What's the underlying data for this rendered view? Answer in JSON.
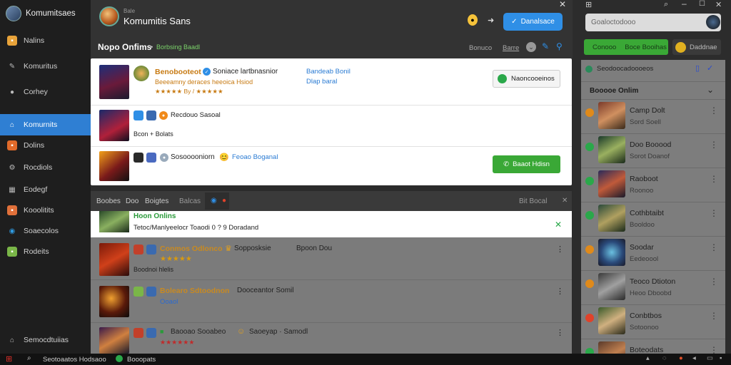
{
  "app": {
    "title": "Komumitsaes"
  },
  "sidebar": {
    "items": [
      {
        "label": "Nalins",
        "icon": "folder-icon",
        "color": "#e8a33a"
      },
      {
        "label": "Komuritus",
        "icon": "pencil-icon",
        "color": "#bdbdbd"
      },
      {
        "label": "Corhey",
        "icon": "circle-icon",
        "color": "#bdbdbd"
      },
      {
        "label": "Komurnits",
        "icon": "home-icon",
        "color": "#ffffff"
      },
      {
        "label": "Dolins",
        "icon": "gamepad-icon",
        "color": "#e06a2a"
      },
      {
        "label": "Rocdiols",
        "icon": "gear-icon",
        "color": "#bdbdbd"
      },
      {
        "label": "Eodegf",
        "icon": "grid-icon",
        "color": "#bdbdbd"
      },
      {
        "label": "Kooolitits",
        "icon": "puzzle-icon",
        "color": "#e0703a"
      },
      {
        "label": "Soaecolos",
        "icon": "globe-icon",
        "color": "#2f9ae0"
      },
      {
        "label": "Rodeits",
        "icon": "apps-icon",
        "color": "#7ab648"
      }
    ],
    "footer_label": "Semocdtuiias"
  },
  "header": {
    "title_small": "Bale",
    "title": "Komumitis Sans",
    "section": "Nopo Onfims",
    "section_sub": "Borbsing Baadl",
    "join_label": "Danalsace",
    "nav_links": [
      "Bonuco",
      "Barre"
    ]
  },
  "cards": [
    {
      "name": "Benobooteot",
      "tag": "Soniace lartbnasnior",
      "stars": "★★★★★ By / ★★★★★",
      "sub": "Beeeamny deraces heeoica Hsiod",
      "badge": "Bandeab Bonil",
      "badge2": "Dlap baral",
      "action": "Naoncooeinos"
    },
    {
      "name": "Recdouo Sasoal",
      "sub": "Bcon + Bolats"
    },
    {
      "name": "Sosooooniorn",
      "tag": "Feoao Boganal",
      "action": "Baaot Hdisn"
    }
  ],
  "strip": {
    "tabs": [
      "Boobes",
      "Doo",
      "Boigtes",
      "Balcas"
    ],
    "right": "Bit Bocal"
  },
  "notice": {
    "title": "Hoon Onlins",
    "text": "Tetoc/Manlyeelocr Toaodi 0 ? 9 Doradand"
  },
  "dim_rows": [
    {
      "name": "Conmos Odlonco",
      "tag": "Sopposksie",
      "tag2": "Bpoon Dou",
      "stars": "★★★★★",
      "sub": "Boodnoi hlelis"
    },
    {
      "name": "Bolearo Sdtoodnon",
      "tag": "Dooceantor Somil",
      "sub": "Ooaol"
    },
    {
      "name": "Baooao Sooabeo",
      "tag": "Saoeyap · Samodl",
      "stars": "★★★★★★"
    }
  ],
  "right": {
    "search_placeholder": "Goaloctodooo",
    "btn_green": "Conooo",
    "btn_green2": "Boce Booihas",
    "btn_dark": "Daddnae",
    "list_head": "Seodoocadoooeos",
    "section": "Booooe Onlim",
    "friends": [
      {
        "name": "Camp Dolt",
        "status": "Sord Soell",
        "dot": "#e08a1a"
      },
      {
        "name": "Doo Booood",
        "status": "Sorot Doanof",
        "dot": "#2aa84a"
      },
      {
        "name": "Raoboot",
        "status": "Roonoo",
        "dot": "#2aa84a"
      },
      {
        "name": "Cothbtaibt",
        "status": "Booldoo",
        "dot": "#2aa84a"
      },
      {
        "name": "Soodar",
        "status": "Eedeoool",
        "dot": "#e08a1a"
      },
      {
        "name": "Teoco Dtioton",
        "status": "Heoo Dboobd",
        "dot": "#e08a1a"
      },
      {
        "name": "Conbtbos",
        "status": "Sotoonoo",
        "dot": "#e0422a"
      },
      {
        "name": "Boteodats",
        "status": "",
        "dot": "#2aa84a"
      }
    ]
  },
  "taskbar": {
    "search": "Seotoaatos Hodsaoo",
    "app": "Booopats"
  }
}
